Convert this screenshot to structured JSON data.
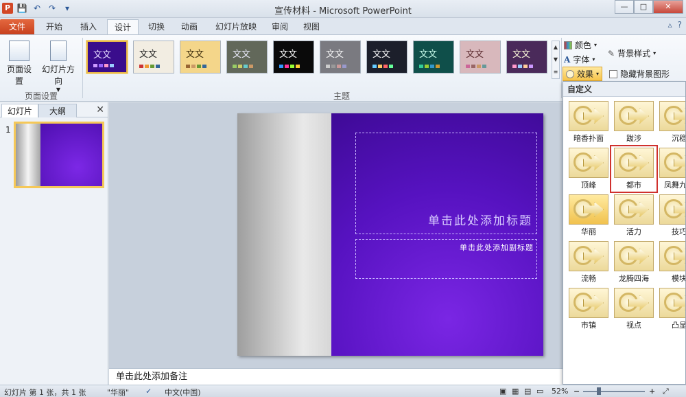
{
  "window": {
    "app_icon": "P",
    "title": "宣传材料 - Microsoft PowerPoint",
    "min": "—",
    "max": "□",
    "close": "✕"
  },
  "qat": [
    {
      "name": "save-icon",
      "glyph": "💾"
    },
    {
      "name": "undo-icon",
      "glyph": "↶"
    },
    {
      "name": "redo-icon",
      "glyph": "↷"
    },
    {
      "name": "customize-icon",
      "glyph": "▾"
    }
  ],
  "tabs": [
    {
      "label": "文件",
      "type": "file"
    },
    {
      "label": "开始"
    },
    {
      "label": "插入"
    },
    {
      "label": "设计",
      "active": true
    },
    {
      "label": "切换"
    },
    {
      "label": "动画"
    },
    {
      "label": "幻灯片放映"
    },
    {
      "label": "审阅"
    },
    {
      "label": "视图"
    }
  ],
  "ribbon": {
    "page_setup_label": "页面设置",
    "slide_orientation_label": "幻灯片方向",
    "page_setup_group": "页面设置",
    "themes_group": "主题",
    "themes": [
      {
        "text": "文文",
        "bg": "#3a0d8c",
        "fg": "#e6dcff"
      },
      {
        "text": "文文",
        "bg": "#f2ede2",
        "fg": "#222"
      },
      {
        "text": "文文",
        "bg": "#f4d68a",
        "fg": "#3a2a0a"
      },
      {
        "text": "文文",
        "bg": "#62685a",
        "fg": "#eef"
      },
      {
        "text": "文文",
        "bg": "#0a0a0a",
        "fg": "#fff"
      },
      {
        "text": "文文",
        "bg": "#7a7a80",
        "fg": "#f5f5f5"
      },
      {
        "text": "文文",
        "bg": "#1c1f2b",
        "fg": "#fff"
      },
      {
        "text": "文文",
        "bg": "#0f4f4a",
        "fg": "#cfe"
      },
      {
        "text": "文文",
        "bg": "#d8b8bc",
        "fg": "#5a2a2e"
      },
      {
        "text": "文文",
        "bg": "#4a2a5a",
        "fg": "#ffd"
      }
    ],
    "colors_label": "颜色",
    "fonts_label": "字体",
    "effects_label": "效果",
    "background_styles_label": "背景样式",
    "hide_background_label": "隐藏背景图形"
  },
  "left_pane": {
    "tab_slides": "幻灯片",
    "tab_outline": "大纲",
    "close": "✕",
    "slide_number": "1"
  },
  "slide": {
    "title_placeholder": "单击此处添加标题",
    "subtitle_placeholder": "单击此处添加副标题"
  },
  "notes_placeholder": "单击此处添加备注",
  "effects_menu": {
    "header": "自定义",
    "items": [
      "暗香扑面",
      "跋涉",
      "沉稳",
      "顶峰",
      "都市",
      "凤舞九天",
      "华丽",
      "活力",
      "技巧",
      "流畅",
      "龙腾四海",
      "模块",
      "市镇",
      "视点",
      "凸显"
    ],
    "selected": "华丽",
    "highlighted": "都市"
  },
  "statusbar": {
    "slide_info": "幻灯片 第 1 张，共 1 张",
    "theme_name": "\"华丽\"",
    "language": "中文(中国)",
    "zoom": "52%",
    "zoom_minus": "−",
    "zoom_plus": "+"
  },
  "colors": {
    "accent_orange": "#d24726",
    "slide_purple": "#5612c0",
    "highlight_red": "#d0312d"
  }
}
